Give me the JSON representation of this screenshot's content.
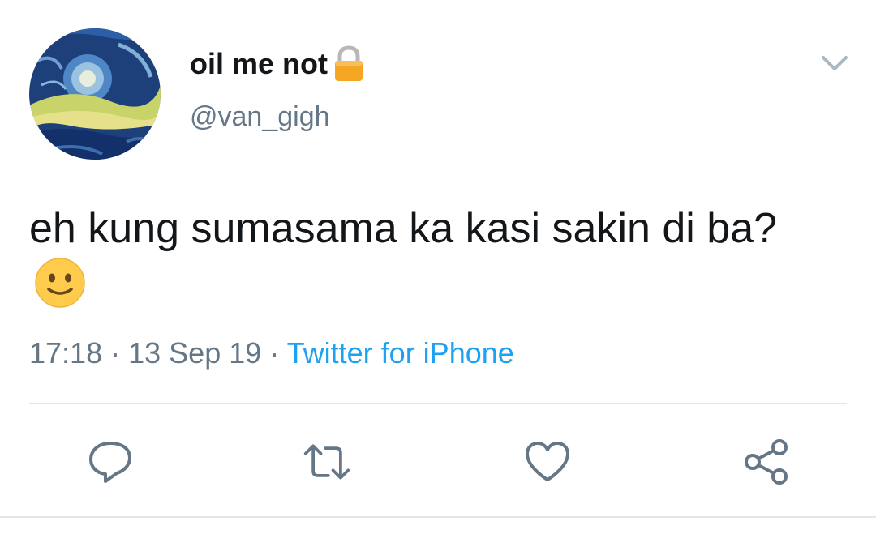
{
  "tweet": {
    "display_name": "oil me not",
    "handle": "@van_gigh",
    "text": "eh kung sumasama ka kasi sakin di ba?",
    "time": "17:18",
    "date": "13 Sep 19",
    "separator": "·",
    "source": "Twitter for iPhone"
  },
  "icons": {
    "lock": "lock-icon",
    "emoji": "slightly-smiling-face-icon",
    "more": "chevron-down-icon",
    "reply": "reply-icon",
    "retweet": "retweet-icon",
    "like": "heart-icon",
    "share": "share-icon"
  },
  "colors": {
    "text": "#14171a",
    "secondary": "#657786",
    "link": "#1da1f2",
    "divider": "#e1e8ed"
  }
}
